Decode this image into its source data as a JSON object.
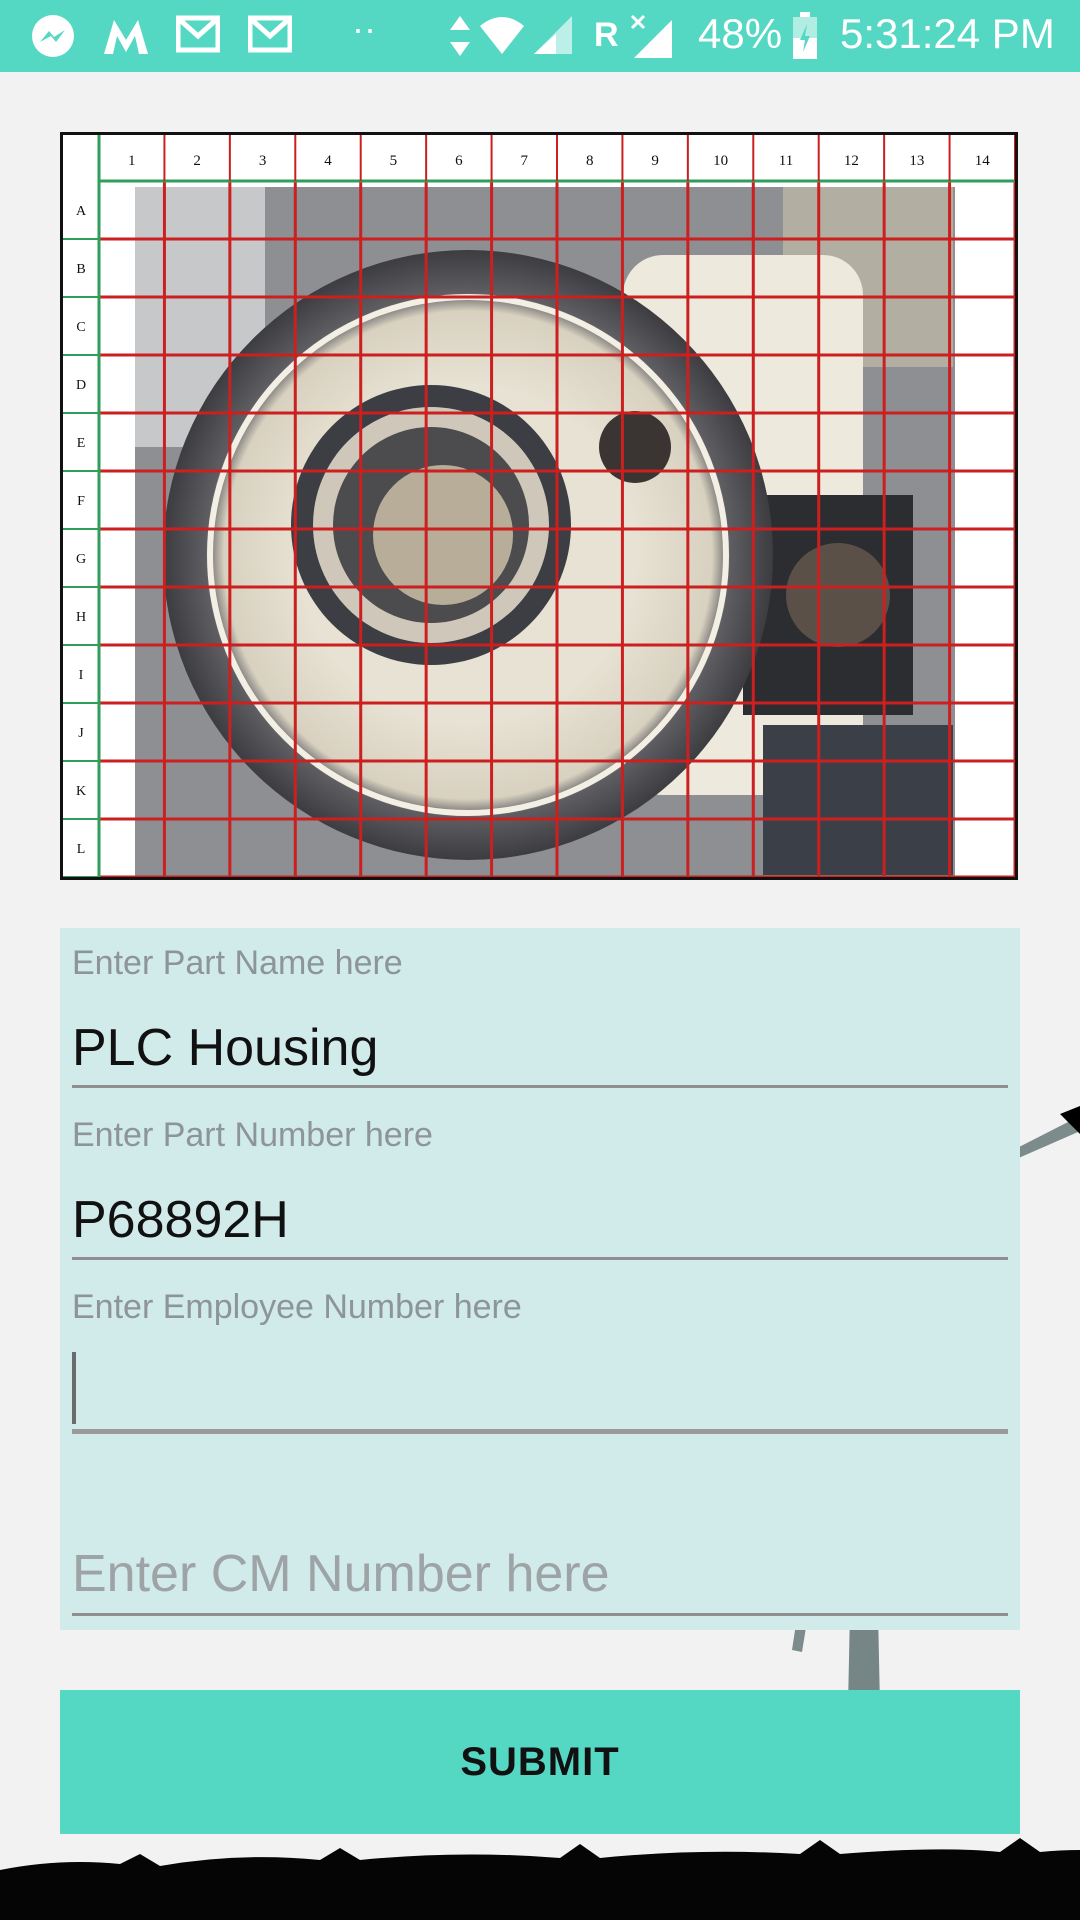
{
  "status_bar": {
    "notification_icons": [
      "messenger-icon",
      "m-app-icon",
      "gmail-icon",
      "gmail-icon"
    ],
    "dots": "··",
    "roaming": "R",
    "battery_percent": "48%",
    "time": "5:31:24 PM"
  },
  "grid_image": {
    "columns": [
      "1",
      "2",
      "3",
      "4",
      "5",
      "6",
      "7",
      "8",
      "9",
      "10",
      "11",
      "12",
      "13",
      "14"
    ],
    "rows": [
      "A",
      "B",
      "C",
      "D",
      "E",
      "F",
      "G",
      "H",
      "I",
      "J",
      "K",
      "L"
    ],
    "grid_color": "#cc1f1f",
    "header_line_color": "#2e9e5a"
  },
  "form": {
    "part_name_label": "Enter Part Name here",
    "part_name_value": "PLC Housing",
    "part_number_label": "Enter Part Number here",
    "part_number_value": "P68892H",
    "employee_number_label": "Enter Employee Number here",
    "employee_number_value": "",
    "cm_number_placeholder": "Enter CM Number here"
  },
  "submit_label": "SUBMIT",
  "colors": {
    "accent": "#55d8c3",
    "panel": "#d1eaea"
  }
}
